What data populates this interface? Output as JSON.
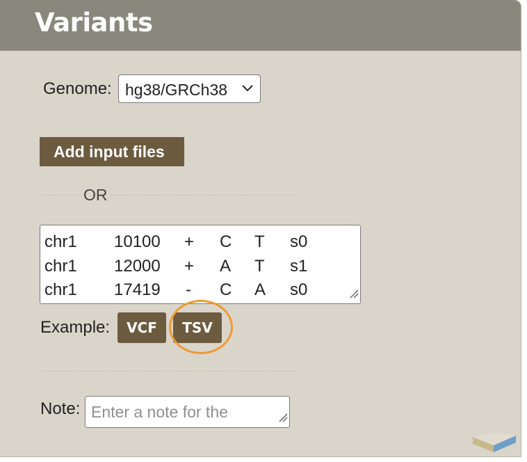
{
  "panel": {
    "title": "Variants"
  },
  "genome": {
    "label": "Genome:",
    "selected": "hg38/GRCh38"
  },
  "add_files_button": "Add input files",
  "or_text": "OR",
  "variants_input": {
    "rows": [
      [
        "chr1",
        "10100",
        "+",
        "C",
        "T",
        "s0"
      ],
      [
        "chr1",
        "12000",
        "+",
        "A",
        "T",
        "s1"
      ],
      [
        "chr1",
        "17419",
        "-",
        "C",
        "A",
        "s0"
      ]
    ]
  },
  "example": {
    "label": "Example:",
    "buttons": [
      "VCF",
      "TSV"
    ]
  },
  "note": {
    "label": "Note:",
    "placeholder": "Enter a note for the"
  },
  "colors": {
    "header": "#8a877d",
    "panel": "#dad5ca",
    "button": "#6d5b40",
    "highlight": "#ee9a32"
  }
}
